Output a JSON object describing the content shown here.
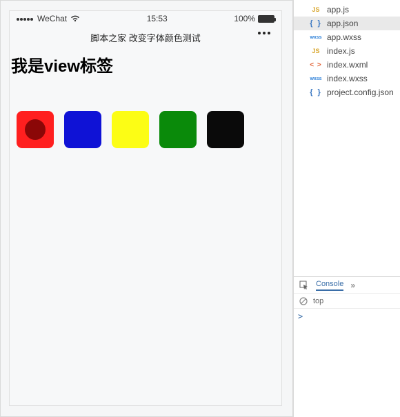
{
  "statusbar": {
    "carrier": "WeChat",
    "time": "15:53",
    "battery_pct": "100%"
  },
  "navbar": {
    "title": "脚本之家 改变字体颜色测试"
  },
  "page": {
    "heading": "我是view标签",
    "colors": [
      {
        "name": "red",
        "hex": "#ff1f1f",
        "selected": true
      },
      {
        "name": "blue",
        "hex": "#0f12d6",
        "selected": false
      },
      {
        "name": "yellow",
        "hex": "#fcfd15",
        "selected": false
      },
      {
        "name": "green",
        "hex": "#0a8a0a",
        "selected": false
      },
      {
        "name": "black",
        "hex": "#0a0a0a",
        "selected": false
      }
    ]
  },
  "files": {
    "items": [
      {
        "icon": "js",
        "label": "app.js",
        "selected": false
      },
      {
        "icon": "json",
        "label": "app.json",
        "selected": true
      },
      {
        "icon": "wxss",
        "label": "app.wxss",
        "selected": false
      },
      {
        "icon": "js",
        "label": "index.js",
        "selected": false
      },
      {
        "icon": "wxml",
        "label": "index.wxml",
        "selected": false
      },
      {
        "icon": "wxss",
        "label": "index.wxss",
        "selected": false
      },
      {
        "icon": "json",
        "label": "project.config.json",
        "selected": false
      }
    ]
  },
  "console": {
    "tab_label": "Console",
    "scope": "top",
    "prompt": ">"
  },
  "icon_glyphs": {
    "js": "JS",
    "json": "{ }",
    "wxss": "wxss",
    "wxml": "< >"
  }
}
